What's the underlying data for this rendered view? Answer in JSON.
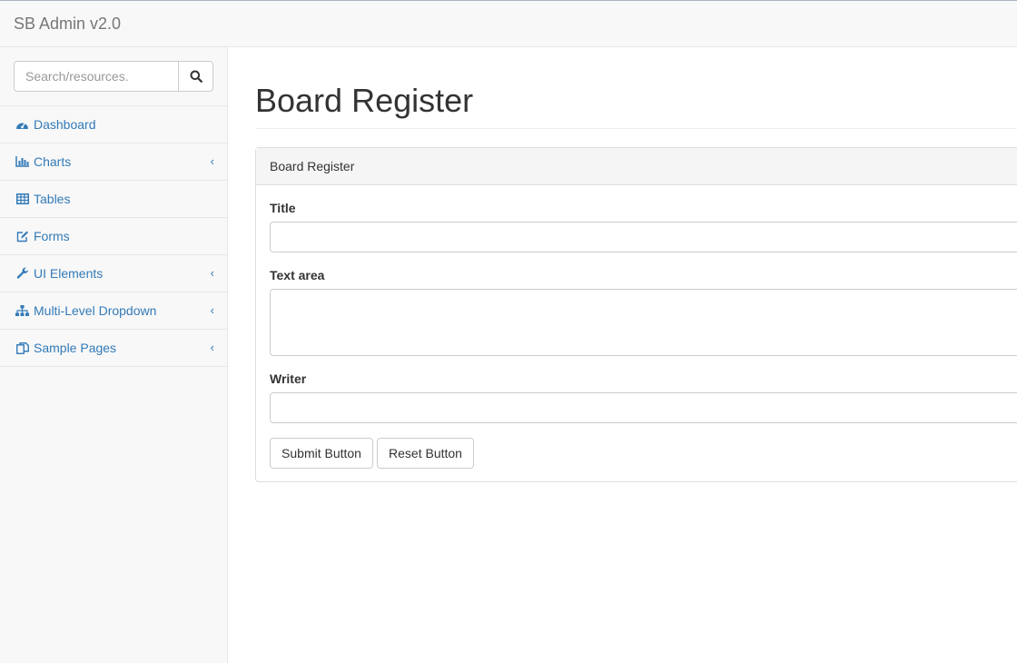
{
  "header": {
    "brand": "SB Admin v2.0"
  },
  "sidebar": {
    "search": {
      "placeholder": "Search/resources."
    },
    "items": [
      {
        "label": "Dashboard",
        "icon": "dashboard-icon",
        "has_submenu": false
      },
      {
        "label": "Charts",
        "icon": "bar-chart-icon",
        "has_submenu": true
      },
      {
        "label": "Tables",
        "icon": "table-icon",
        "has_submenu": false
      },
      {
        "label": "Forms",
        "icon": "edit-icon",
        "has_submenu": false
      },
      {
        "label": "UI Elements",
        "icon": "wrench-icon",
        "has_submenu": true
      },
      {
        "label": "Multi-Level Dropdown",
        "icon": "sitemap-icon",
        "has_submenu": true
      },
      {
        "label": "Sample Pages",
        "icon": "files-icon",
        "has_submenu": true
      }
    ]
  },
  "main": {
    "page_title": "Board Register",
    "panel": {
      "heading": "Board Register",
      "fields": [
        {
          "label": "Title",
          "value": ""
        },
        {
          "label": "Text area",
          "value": ""
        },
        {
          "label": "Writer",
          "value": ""
        }
      ],
      "buttons": {
        "submit": "Submit Button",
        "reset": "Reset Button"
      }
    }
  },
  "colors": {
    "link": "#337ab7",
    "sidebar_bg": "#f8f8f8",
    "border": "#e7e7e7"
  }
}
